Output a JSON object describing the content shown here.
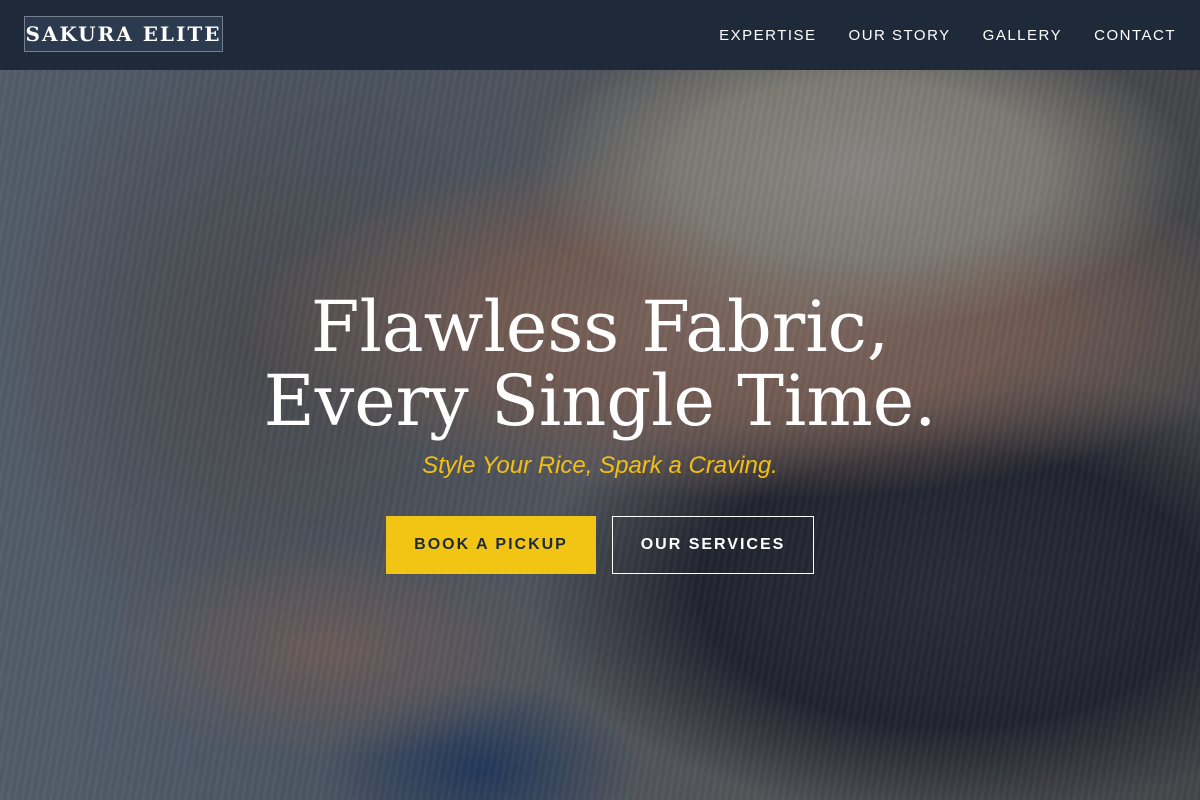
{
  "header": {
    "logo": "SAKURA ELITE",
    "nav": [
      {
        "label": "EXPERTISE"
      },
      {
        "label": "OUR STORY"
      },
      {
        "label": "GALLERY"
      },
      {
        "label": "CONTACT"
      }
    ]
  },
  "hero": {
    "title": "Flawless Fabric, Every Single Time.",
    "tagline": "Style Your Rice, Spark a Craving.",
    "primary_button": "BOOK A PICKUP",
    "secondary_button": "OUR SERVICES"
  },
  "colors": {
    "header_bg": "#1e2939",
    "accent": "#f2c515",
    "tagline": "#f2c015"
  }
}
